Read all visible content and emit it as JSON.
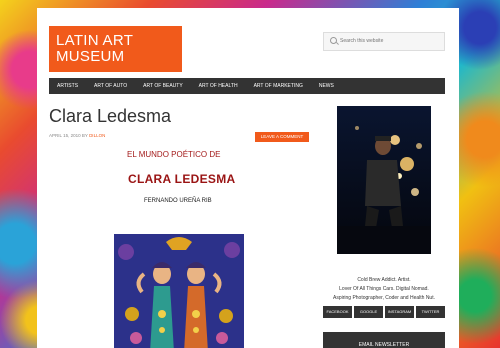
{
  "site": {
    "logo_line1": "LATIN ART",
    "logo_line2": "MUSEUM",
    "brand_color": "#f15a1b"
  },
  "search": {
    "placeholder": "Search this website"
  },
  "nav": {
    "items": [
      "ARTISTS",
      "ART OF AUTO",
      "ART OF BEAUTY",
      "ART OF HEALTH",
      "ART OF MARKETING",
      "NEWS"
    ]
  },
  "post": {
    "title": "Clara Ledesma",
    "date": "APRIL 15, 2010",
    "by": "BY",
    "author": "DILLON",
    "comment_label": "LEAVE A COMMENT",
    "subtitle": "EL MUNDO POÉTICO DE",
    "artist_name": "CLARA LEDESMA",
    "essay_author": "FERNANDO UREÑA RIB"
  },
  "sidebar": {
    "bio_lines": [
      "Cold Brew Addict. Artist.",
      "Lover Of All Things Cars. Digital Nomad.",
      "Aspiring Photographer, Coder and Health Nut."
    ],
    "social": [
      "FACEBOOK",
      "GOOGLE",
      "INSTAGRAM",
      "TWITTER"
    ],
    "newsletter_title": "EMAIL NEWSLETTER"
  }
}
